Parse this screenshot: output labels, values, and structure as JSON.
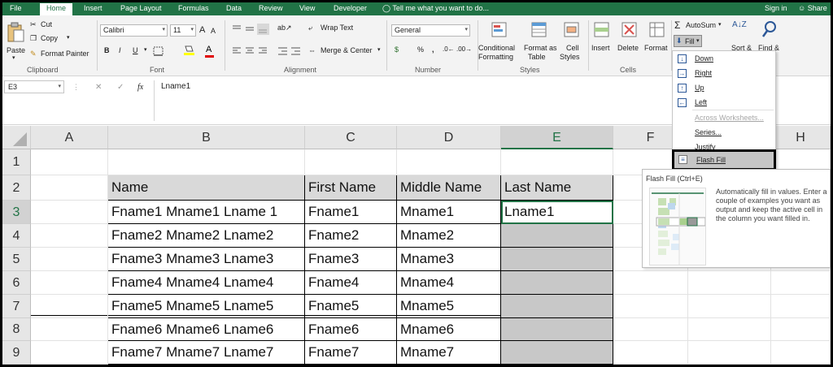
{
  "tabs": [
    "File",
    "Home",
    "Insert",
    "Page Layout",
    "Formulas",
    "Data",
    "Review",
    "View",
    "Developer"
  ],
  "tell_me": "Tell me what you want to do...",
  "sign_in": "Sign in",
  "share": "Share",
  "ribbon": {
    "clipboard": {
      "paste": "Paste",
      "cut": "Cut",
      "copy": "Copy",
      "format_painter": "Format Painter",
      "label": "Clipboard"
    },
    "font": {
      "name": "Calibri",
      "size": "11",
      "bold": "B",
      "italic": "I",
      "underline": "U",
      "grow": "A",
      "shrink": "A",
      "color_a": "A",
      "label": "Font"
    },
    "alignment": {
      "wrap_text": "Wrap Text",
      "merge_center": "Merge & Center",
      "label": "Alignment"
    },
    "number": {
      "format": "General",
      "currency": "$",
      "percent": "%",
      "comma": ",",
      "label": "Number"
    },
    "styles": {
      "conditional_1": "Conditional",
      "conditional_2": "Formatting",
      "format_as_1": "Format as",
      "format_as_2": "Table",
      "cell_1": "Cell",
      "cell_2": "Styles",
      "label": "Styles"
    },
    "cells": {
      "insert": "Insert",
      "delete": "Delete",
      "format": "Format",
      "label": "Cells"
    },
    "editing": {
      "autosum": "AutoSum",
      "fill": "Fill",
      "sort": "Sort &",
      "find": "Find &"
    }
  },
  "name_box": "E3",
  "formula_cancel": "✕",
  "formula_enter": "✓",
  "formula_fx": "fx",
  "formula_value": "Lname1",
  "columns": [
    "A",
    "B",
    "C",
    "D",
    "E",
    "F",
    "G",
    "H"
  ],
  "rows": [
    "1",
    "2",
    "3",
    "4",
    "5",
    "6",
    "7",
    "8",
    "9"
  ],
  "table": {
    "headers": [
      "Name",
      "First Name",
      "Middle Name",
      "Last Name"
    ],
    "rows": [
      [
        "Fname1 Mname1 Lname 1",
        "Fname1",
        "Mname1",
        "Lname1"
      ],
      [
        "Fname2 Mname2 Lname2",
        "Fname2",
        "Mname2",
        ""
      ],
      [
        "Fname3 Mname3 Lname3",
        "Fname3",
        "Mname3",
        ""
      ],
      [
        "Fname4 Mname4 Lname4",
        "Fname4",
        "Mname4",
        ""
      ],
      [
        "Fname5 Mname5 Lname5",
        "Fname5",
        "Mname5",
        ""
      ],
      [
        "Fname6 Mname6 Lname6",
        "Fname6",
        "Mname6",
        ""
      ],
      [
        "Fname7 Mname7 Lname7",
        "Fname7",
        "Mname7",
        ""
      ]
    ]
  },
  "fill_menu": {
    "items": [
      {
        "label": "Down",
        "icon": "arrow-down-icon",
        "disabled": false
      },
      {
        "label": "Right",
        "icon": "arrow-right-icon",
        "disabled": false
      },
      {
        "label": "Up",
        "icon": "arrow-up-icon",
        "disabled": false
      },
      {
        "label": "Left",
        "icon": "arrow-left-icon",
        "disabled": false
      },
      {
        "label": "Across Worksheets...",
        "icon": "",
        "disabled": true
      },
      {
        "label": "Series...",
        "icon": "",
        "disabled": false
      },
      {
        "label": "Justify",
        "icon": "",
        "disabled": false
      },
      {
        "label": "Flash Fill",
        "icon": "flash-fill-icon",
        "disabled": false
      }
    ]
  },
  "tooltip": {
    "title": "Flash Fill (Ctrl+E)",
    "body": "Automatically fill in values. Enter a couple of examples you want as output and keep the active cell in the column you want filled in."
  },
  "colors": {
    "accent": "#217346",
    "header_fill": "#d9d9d9",
    "grey_fill": "#c8c8c8"
  }
}
